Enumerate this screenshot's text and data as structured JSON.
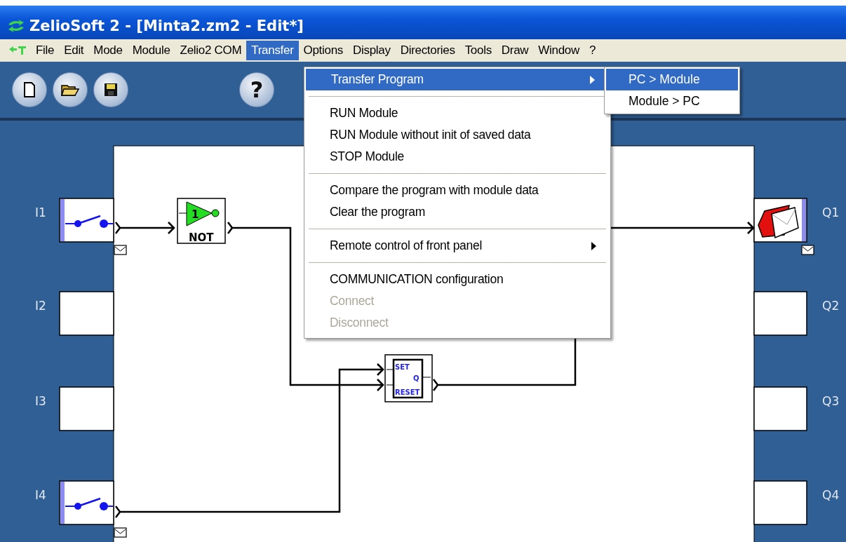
{
  "window": {
    "title": "ZelioSoft 2 - [Minta2.zm2 - Edit*]"
  },
  "menu": [
    {
      "label": "File",
      "selected": false
    },
    {
      "label": "Edit",
      "selected": false
    },
    {
      "label": "Mode",
      "selected": false
    },
    {
      "label": "Module",
      "selected": false
    },
    {
      "label": "Zelio2 COM",
      "selected": false
    },
    {
      "label": "Transfer",
      "selected": true
    },
    {
      "label": "Options",
      "selected": false
    },
    {
      "label": "Display",
      "selected": false
    },
    {
      "label": "Directories",
      "selected": false
    },
    {
      "label": "Tools",
      "selected": false
    },
    {
      "label": "Draw",
      "selected": false
    },
    {
      "label": "Window",
      "selected": false
    },
    {
      "label": "?",
      "selected": false
    }
  ],
  "toolbar": {
    "help": "?"
  },
  "dropdown": {
    "items": [
      {
        "kind": "item",
        "label": "Transfer Program",
        "selected": true,
        "disabled": false,
        "submenu": true
      },
      {
        "kind": "separator"
      },
      {
        "kind": "item",
        "label": "RUN Module",
        "selected": false,
        "disabled": false,
        "submenu": false
      },
      {
        "kind": "item",
        "label": "RUN Module without init of saved data",
        "selected": false,
        "disabled": false,
        "submenu": false
      },
      {
        "kind": "item",
        "label": "STOP Module",
        "selected": false,
        "disabled": false,
        "submenu": false
      },
      {
        "kind": "separator"
      },
      {
        "kind": "item",
        "label": "Compare the program with module data",
        "selected": false,
        "disabled": false,
        "submenu": false
      },
      {
        "kind": "item",
        "label": "Clear the program",
        "selected": false,
        "disabled": false,
        "submenu": false
      },
      {
        "kind": "separator"
      },
      {
        "kind": "item",
        "label": "Remote control of front panel",
        "selected": false,
        "disabled": false,
        "submenu": true
      },
      {
        "kind": "separator"
      },
      {
        "kind": "item",
        "label": "COMMUNICATION configuration",
        "selected": false,
        "disabled": false,
        "submenu": false
      },
      {
        "kind": "item",
        "label": "Connect",
        "selected": false,
        "disabled": true,
        "submenu": false
      },
      {
        "kind": "item",
        "label": "Disconnect",
        "selected": false,
        "disabled": true,
        "submenu": false
      }
    ]
  },
  "submenu": {
    "items": [
      {
        "label": "PC > Module",
        "selected": true
      },
      {
        "label": "Module > PC",
        "selected": false
      }
    ]
  },
  "inputs": [
    {
      "label": "I1",
      "kind": "switch"
    },
    {
      "label": "I2",
      "kind": "empty"
    },
    {
      "label": "I3",
      "kind": "empty"
    },
    {
      "label": "I4",
      "kind": "switch"
    }
  ],
  "outputs": [
    {
      "label": "Q1",
      "kind": "coil"
    },
    {
      "label": "Q2",
      "kind": "empty"
    },
    {
      "label": "Q3",
      "kind": "empty"
    },
    {
      "label": "Q4",
      "kind": "empty"
    }
  ],
  "not_block": {
    "number": "1",
    "label": "NOT"
  },
  "sr_block": {
    "set": "SET",
    "q": "Q",
    "reset": "RESET"
  }
}
